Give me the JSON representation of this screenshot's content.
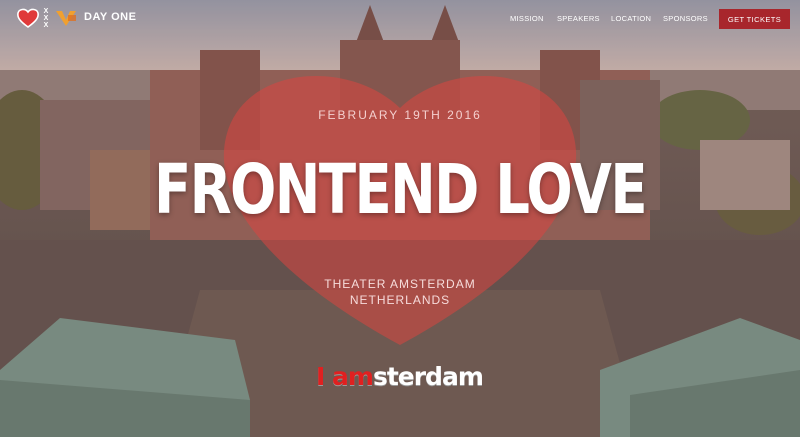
{
  "colors": {
    "accent": "#a8262c",
    "heart": "#e0403c"
  },
  "header": {
    "brand": "DAY ONE",
    "logo_icons": [
      "heart-icon",
      "xxx-icon",
      "v-logo-icon"
    ],
    "xxx_glyph": "X",
    "menu": [
      {
        "label": "MISSION"
      },
      {
        "label": "SPEAKERS"
      },
      {
        "label": "LOCATION"
      },
      {
        "label": "SPONSORS"
      }
    ],
    "cta_label": "GET TICKETS"
  },
  "hero": {
    "date": "FEBRUARY 19TH 2016",
    "title": "FRONTEND LOVE",
    "venue_line1": "THEATER AMSTERDAM",
    "venue_line2": "NETHERLANDS",
    "sign_text_red": "I am",
    "sign_text_white": "sterdam"
  }
}
